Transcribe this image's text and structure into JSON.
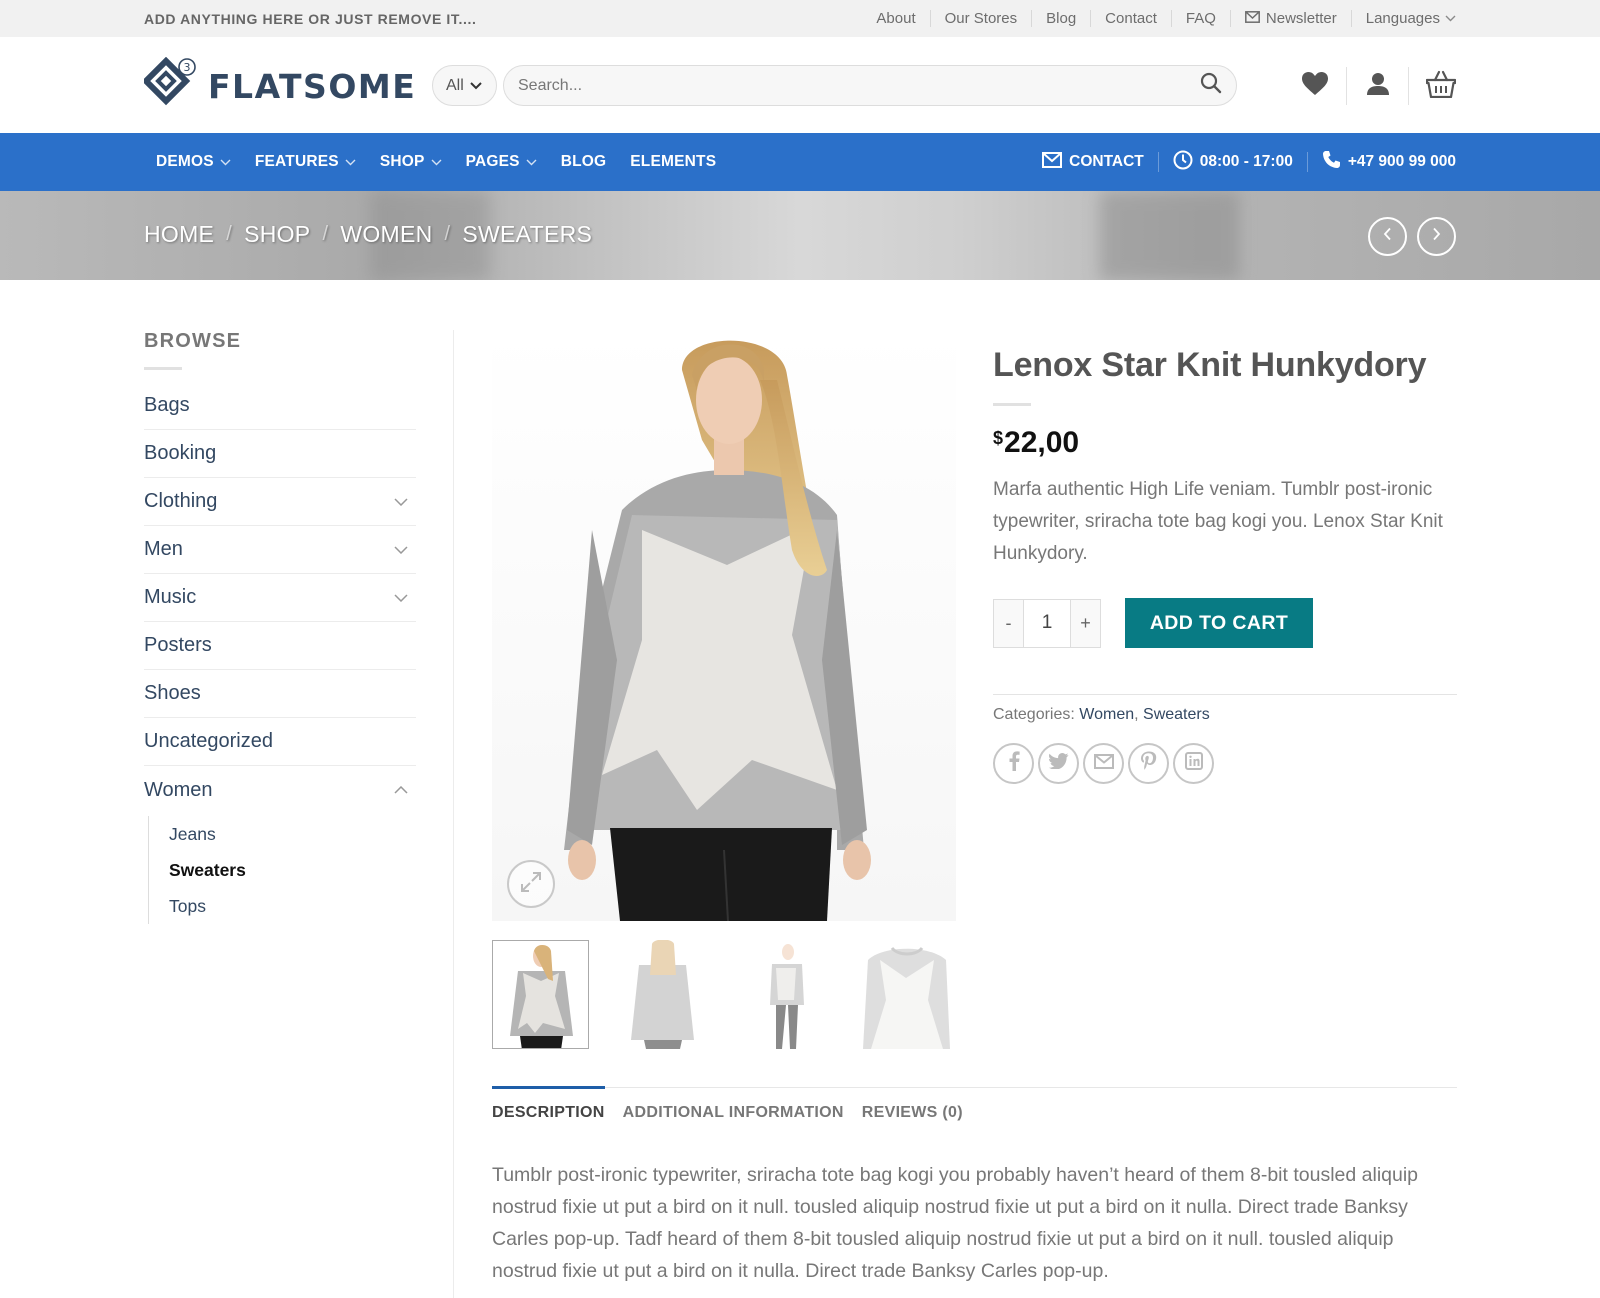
{
  "topbar": {
    "tagline": "ADD ANYTHING HERE OR JUST REMOVE IT....",
    "links": [
      "About",
      "Our Stores",
      "Blog",
      "Contact",
      "FAQ"
    ],
    "newsletter": "Newsletter",
    "languages": "Languages"
  },
  "header": {
    "logo_text": "FLATSOME",
    "logo_badge": "3",
    "search_category": "All",
    "search_placeholder": "Search..."
  },
  "nav": {
    "items": [
      "DEMOS",
      "FEATURES",
      "SHOP",
      "PAGES",
      "BLOG",
      "ELEMENTS"
    ],
    "contact": "CONTACT",
    "hours": "08:00 - 17:00",
    "phone": "+47 900 99 000"
  },
  "breadcrumb": [
    "HOME",
    "SHOP",
    "WOMEN",
    "SWEATERS"
  ],
  "sidebar": {
    "title": "BROWSE",
    "categories": [
      "Bags",
      "Booking",
      "Clothing",
      "Men",
      "Music",
      "Posters",
      "Shoes",
      "Uncategorized",
      "Women"
    ],
    "subcategories": [
      "Jeans",
      "Sweaters",
      "Tops"
    ]
  },
  "product": {
    "title": "Lenox Star Knit Hunkydory",
    "currency": "$",
    "price": "22,00",
    "short_description": "Marfa authentic High Life veniam. Tumblr post-ironic typewriter, sriracha tote bag kogi you. Lenox Star Knit Hunkydory.",
    "qty_minus": "-",
    "qty": "1",
    "qty_plus": "+",
    "add_to_cart": "ADD TO CART",
    "categories_label": "Categories:",
    "categories": [
      "Women",
      "Sweaters"
    ]
  },
  "tabs": {
    "items": [
      "DESCRIPTION",
      "ADDITIONAL INFORMATION",
      "REVIEWS (0)"
    ],
    "description": "Tumblr post-ironic typewriter, sriracha tote bag kogi you probably haven’t heard of them 8-bit tousled aliquip nostrud fixie ut put a bird on it null. tousled aliquip nostrud fixie ut put a bird on it nulla. Direct trade Banksy Carles pop-up. Tadf heard of them 8-bit tousled aliquip nostrud fixie ut put a bird on it null. tousled aliquip nostrud fixie ut put a bird on it nulla. Direct trade Banksy Carles pop-up."
  },
  "colors": {
    "nav_blue": "#2b70c9",
    "cart_teal": "#087b84",
    "link_navy": "#334862"
  }
}
